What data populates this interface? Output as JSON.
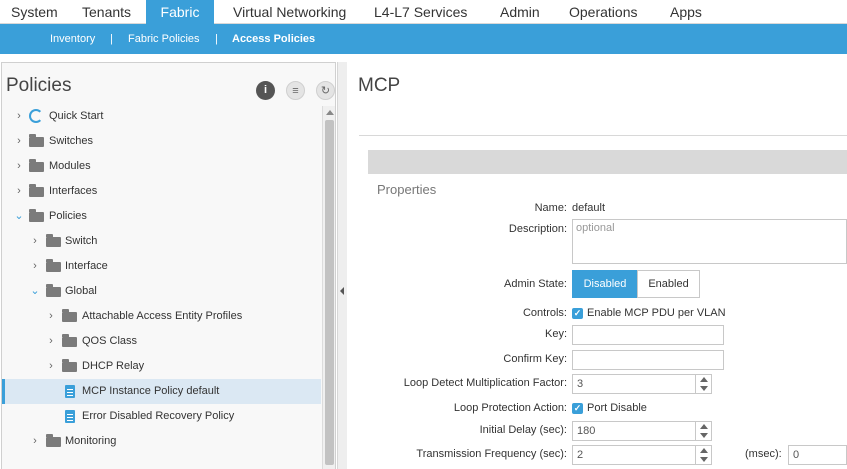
{
  "top_tabs": [
    "System",
    "Tenants",
    "Fabric",
    "Virtual Networking",
    "L4-L7 Services",
    "Admin",
    "Operations",
    "Apps"
  ],
  "sub_nav": {
    "items": [
      "Inventory",
      "Fabric Policies",
      "Access Policies"
    ],
    "separator": "|"
  },
  "left_pane": {
    "title": "Policies",
    "tree": [
      "Quick Start",
      "Switches",
      "Modules",
      "Interfaces",
      "Policies",
      "Switch",
      "Interface",
      "Global",
      "Attachable Access Entity Profiles",
      "QOS Class",
      "DHCP Relay",
      "MCP Instance Policy default",
      "Error Disabled Recovery Policy",
      "Monitoring"
    ]
  },
  "right_pane": {
    "title": "MCP",
    "section": "Properties",
    "fields": {
      "name_label": "Name:",
      "name_value": "default",
      "description_label": "Description:",
      "description_placeholder": "optional",
      "admin_state_label": "Admin State:",
      "admin_state_options": [
        "Disabled",
        "Enabled"
      ],
      "controls_label": "Controls:",
      "controls_option": "Enable MCP PDU per VLAN",
      "key_label": "Key:",
      "confirm_key_label": "Confirm Key:",
      "loop_factor_label": "Loop Detect Multiplication Factor:",
      "loop_factor_value": "3",
      "loop_action_label": "Loop Protection Action:",
      "loop_action_option": "Port Disable",
      "initial_delay_label": "Initial Delay (sec):",
      "initial_delay_value": "180",
      "tx_freq_label": "Transmission Frequency (sec):",
      "tx_freq_value": "2",
      "msec_label": "(msec):",
      "msec_value": "0"
    }
  },
  "colors": {
    "accent": "#3a9fd9",
    "selected_row": "#dbe8f3"
  }
}
